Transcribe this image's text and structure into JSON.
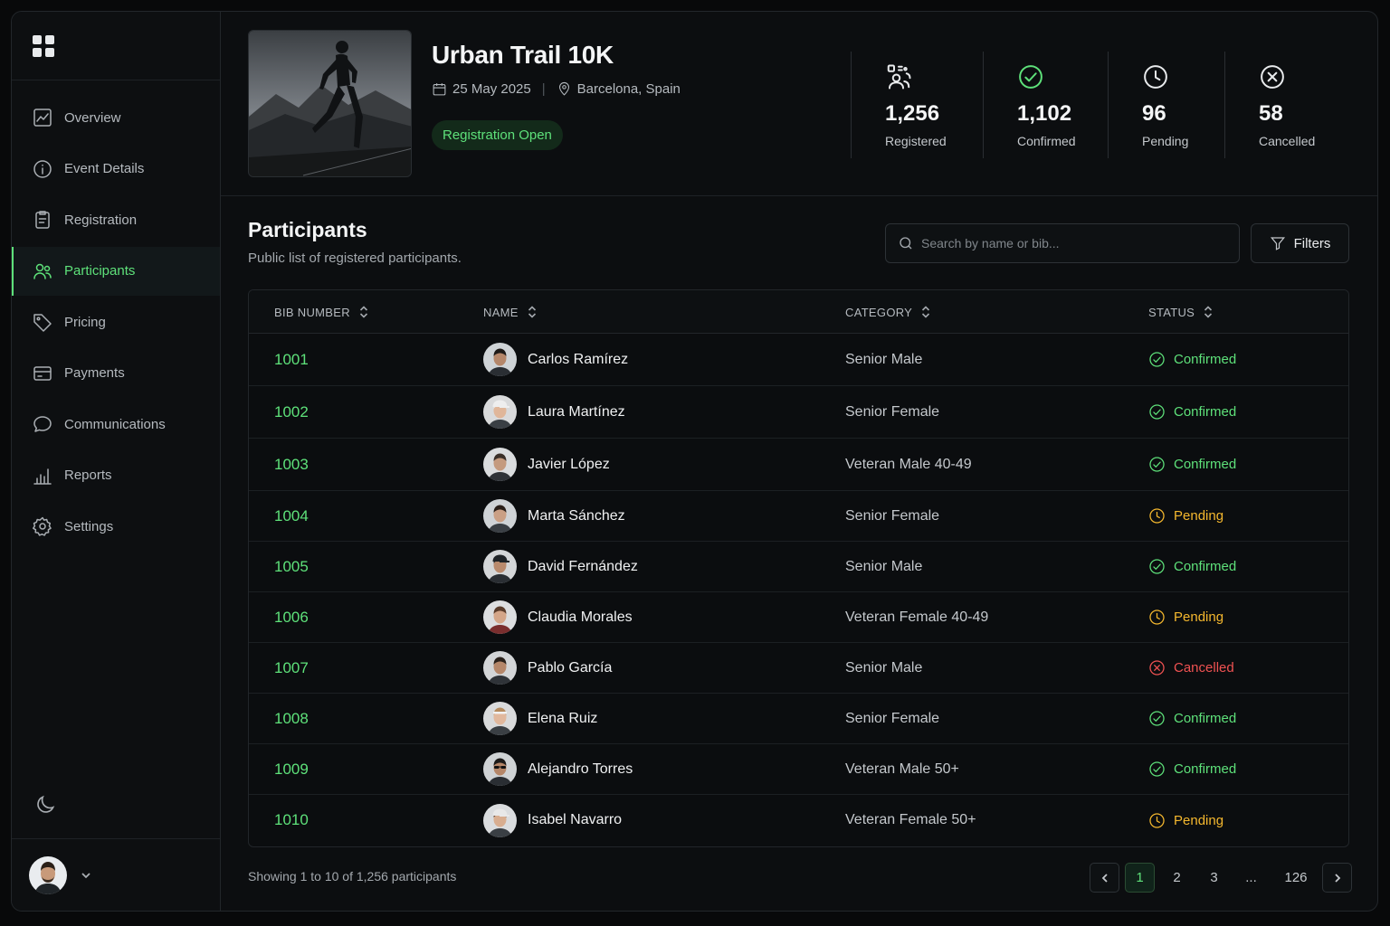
{
  "sidebar": {
    "logo": "grid-logo",
    "items": [
      {
        "label": "Overview",
        "icon": "chart-line-icon"
      },
      {
        "label": "Event Details",
        "icon": "info-circle-icon"
      },
      {
        "label": "Registration",
        "icon": "clipboard-icon"
      },
      {
        "label": "Participants",
        "icon": "users-icon",
        "active": true
      },
      {
        "label": "Pricing",
        "icon": "tag-icon"
      },
      {
        "label": "Payments",
        "icon": "credit-card-icon"
      },
      {
        "label": "Communications",
        "icon": "chat-bubble-icon"
      },
      {
        "label": "Reports",
        "icon": "bar-chart-icon"
      },
      {
        "label": "Settings",
        "icon": "gear-icon"
      }
    ],
    "theme_icon": "moon-icon",
    "user_menu_icon": "chevron-down-icon"
  },
  "event": {
    "title": "Urban Trail 10K",
    "date": "25 May 2025",
    "separator": "|",
    "location": "Barcelona, Spain",
    "badge": "Registration Open"
  },
  "stats": [
    {
      "value": "1,256",
      "label": "Registered",
      "icon": "users-badge-icon",
      "color": "#e8eaec"
    },
    {
      "value": "1,102",
      "label": "Confirmed",
      "icon": "check-circle-icon",
      "color": "#5ee17a"
    },
    {
      "value": "96",
      "label": "Pending",
      "icon": "clock-icon",
      "color": "#e8eaec"
    },
    {
      "value": "58",
      "label": "Cancelled",
      "icon": "x-circle-icon",
      "color": "#e8eaec"
    }
  ],
  "participants": {
    "title": "Participants",
    "subtitle": "Public list of registered participants.",
    "search_placeholder": "Search by name or bib...",
    "filters_label": "Filters",
    "columns": [
      "BIB NUMBER",
      "NAME",
      "CATEGORY",
      "STATUS"
    ],
    "rows": [
      {
        "bib": "1001",
        "name": "Carlos Ramírez",
        "category": "Senior Male",
        "status": "Confirmed"
      },
      {
        "bib": "1002",
        "name": "Laura Martínez",
        "category": "Senior Female",
        "status": "Confirmed"
      },
      {
        "bib": "1003",
        "name": "Javier López",
        "category": "Veteran Male 40-49",
        "status": "Confirmed"
      },
      {
        "bib": "1004",
        "name": "Marta Sánchez",
        "category": "Senior Female",
        "status": "Pending"
      },
      {
        "bib": "1005",
        "name": "David Fernández",
        "category": "Senior Male",
        "status": "Confirmed"
      },
      {
        "bib": "1006",
        "name": "Claudia Morales",
        "category": "Veteran Female 40-49",
        "status": "Pending"
      },
      {
        "bib": "1007",
        "name": "Pablo García",
        "category": "Senior Male",
        "status": "Cancelled"
      },
      {
        "bib": "1008",
        "name": "Elena Ruiz",
        "category": "Senior Female",
        "status": "Confirmed"
      },
      {
        "bib": "1009",
        "name": "Alejandro Torres",
        "category": "Veteran Male 50+",
        "status": "Confirmed"
      },
      {
        "bib": "1010",
        "name": "Isabel Navarro",
        "category": "Veteran Female 50+",
        "status": "Pending"
      }
    ],
    "showing": "Showing 1 to 10 of 1,256 participants",
    "pagination": [
      "1",
      "2",
      "3",
      "...",
      "126"
    ],
    "current_page": "1"
  },
  "colors": {
    "accent": "#5ee17a",
    "pending": "#f5b82e",
    "cancelled": "#f05252"
  }
}
